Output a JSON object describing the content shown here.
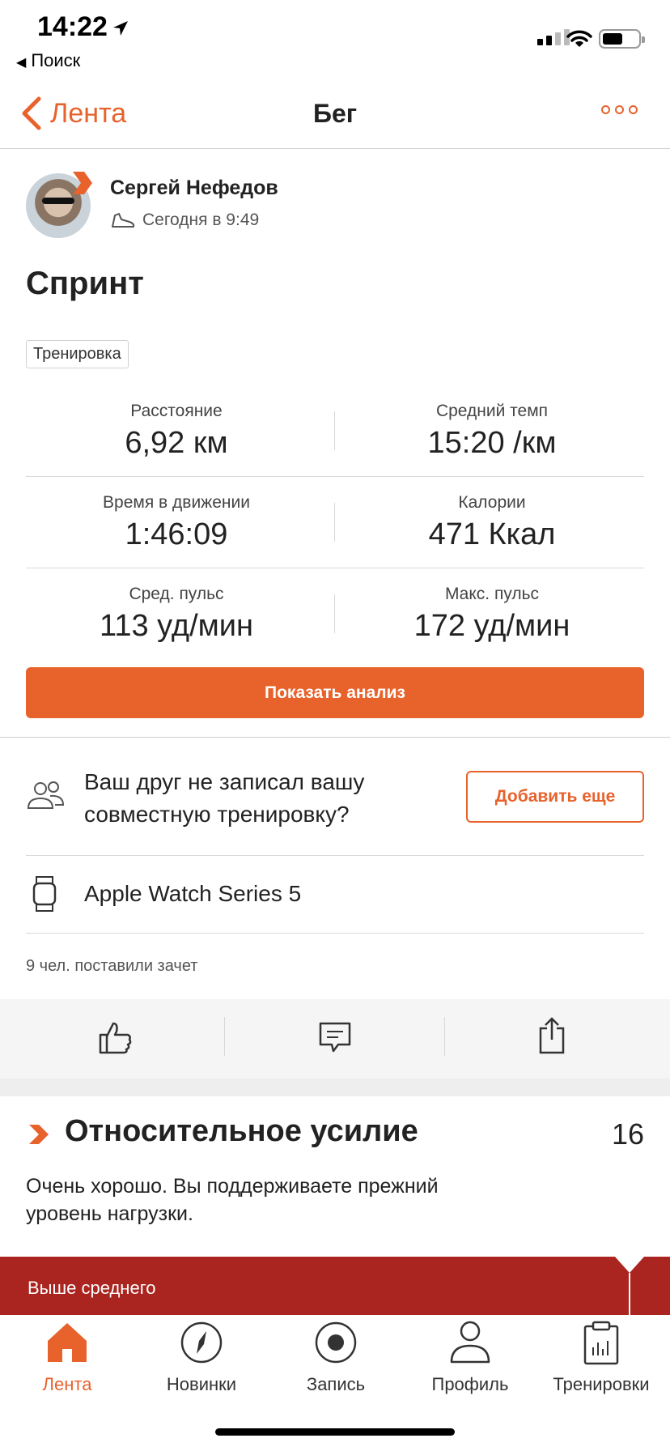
{
  "status_bar": {
    "time": "14:22",
    "back_app": "Поиск"
  },
  "nav": {
    "back_label": "Лента",
    "title": "Бег"
  },
  "author": {
    "name": "Сергей Нефедов",
    "time": "Сегодня в 9:49"
  },
  "activity": {
    "title": "Спринт",
    "tag": "Тренировка"
  },
  "stats": [
    {
      "label": "Расстояние",
      "value": "6,92 км"
    },
    {
      "label": "Средний темп",
      "value": "15:20 /км"
    },
    {
      "label": "Время в движении",
      "value": "1:46:09"
    },
    {
      "label": "Калории",
      "value": "471 Ккал"
    },
    {
      "label": "Сред. пульс",
      "value": "113 уд/мин"
    },
    {
      "label": "Макс. пульс",
      "value": "172 уд/мин"
    }
  ],
  "analysis_button": "Показать анализ",
  "friend_prompt": {
    "text": "Ваш друг не записал вашу совместную тренировку?",
    "button": "Добавить еще"
  },
  "device": {
    "name": "Apple Watch Series 5"
  },
  "kudos_text": "9 чел. поставили зачет",
  "relative_effort": {
    "title": "Относительное усилие",
    "value": "16",
    "description": "Очень хорошо. Вы поддерживаете прежний уровень нагрузки.",
    "level_label": "Выше среднего"
  },
  "tabs": [
    {
      "label": "Лента",
      "icon": "home-icon",
      "active": true
    },
    {
      "label": "Новинки",
      "icon": "compass-icon",
      "active": false
    },
    {
      "label": "Запись",
      "icon": "record-icon",
      "active": false
    },
    {
      "label": "Профиль",
      "icon": "profile-icon",
      "active": false
    },
    {
      "label": "Тренировки",
      "icon": "training-icon",
      "active": false
    }
  ],
  "colors": {
    "accent": "#e8622c",
    "effort_bar": "#aa2420"
  }
}
